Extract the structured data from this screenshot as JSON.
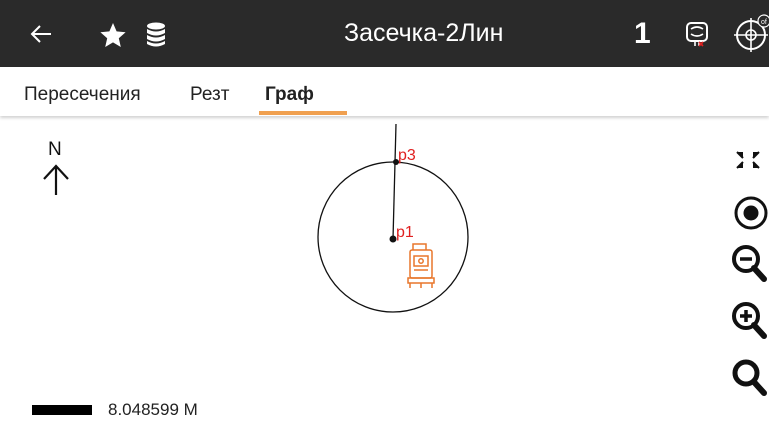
{
  "header": {
    "title": "Засечка-2Лин",
    "count": "1",
    "icons": [
      "back-arrow-icon",
      "star-icon",
      "database-icon",
      "device-icon",
      "crosshair-target-icon"
    ]
  },
  "tabs": [
    {
      "label": "Пересечения",
      "active": false
    },
    {
      "label": "Резт",
      "active": false
    },
    {
      "label": "Граф",
      "active": true
    }
  ],
  "map": {
    "north_label": "N",
    "points": [
      {
        "label": "p3"
      },
      {
        "label": "p1"
      }
    ],
    "scale_text": "8.048599 M",
    "side_controls": [
      "collapse-icon",
      "center-location-icon",
      "zoom-out-icon",
      "zoom-in-icon",
      "search-icon"
    ]
  },
  "colors": {
    "app_bar": "#2a2a2a",
    "tab_accent": "#f0a050",
    "point_label": "#e02020",
    "instrument": "#e8772c"
  }
}
